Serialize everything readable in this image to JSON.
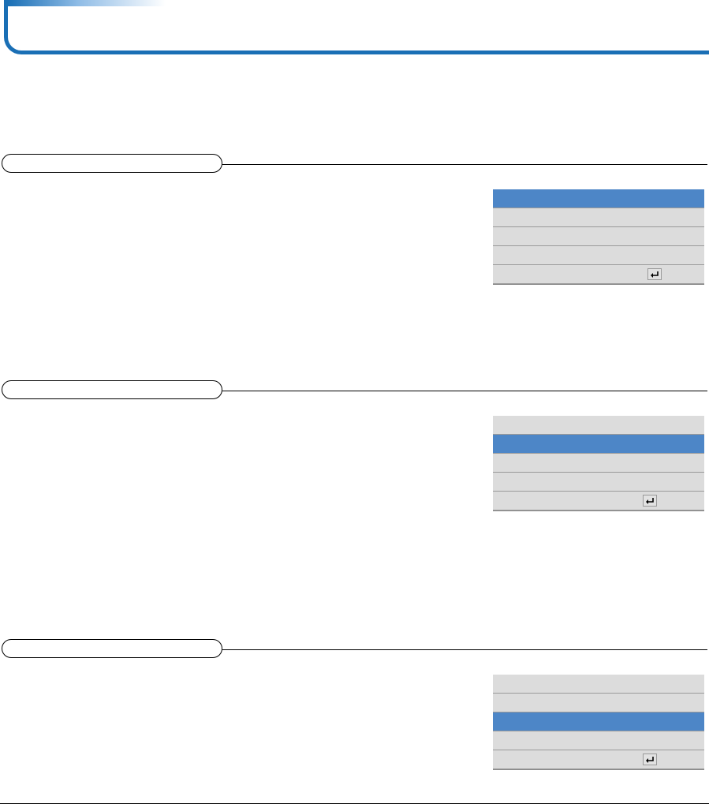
{
  "header": {
    "title": ""
  },
  "colors": {
    "accent": "#1a6fb5",
    "selected_row": "#4d86c7",
    "row_bg": "#dcdcdc"
  },
  "sections": [
    {
      "title": "",
      "menu": {
        "rows": [
          {
            "label": "",
            "selected": true
          },
          {
            "label": "",
            "selected": false
          },
          {
            "label": "",
            "selected": false
          },
          {
            "label": "",
            "selected": false
          },
          {
            "label": "",
            "selected": false,
            "icon": "enter-icon"
          }
        ]
      }
    },
    {
      "title": "",
      "menu": {
        "rows": [
          {
            "label": "",
            "selected": false
          },
          {
            "label": "",
            "selected": true
          },
          {
            "label": "",
            "selected": false
          },
          {
            "label": "",
            "selected": false
          },
          {
            "label": "",
            "selected": false,
            "icon": "enter-icon"
          }
        ]
      }
    },
    {
      "title": "",
      "menu": {
        "rows": [
          {
            "label": "",
            "selected": false
          },
          {
            "label": "",
            "selected": false
          },
          {
            "label": "",
            "selected": true
          },
          {
            "label": "",
            "selected": false
          },
          {
            "label": "",
            "selected": false,
            "icon": "enter-icon"
          }
        ]
      }
    }
  ]
}
